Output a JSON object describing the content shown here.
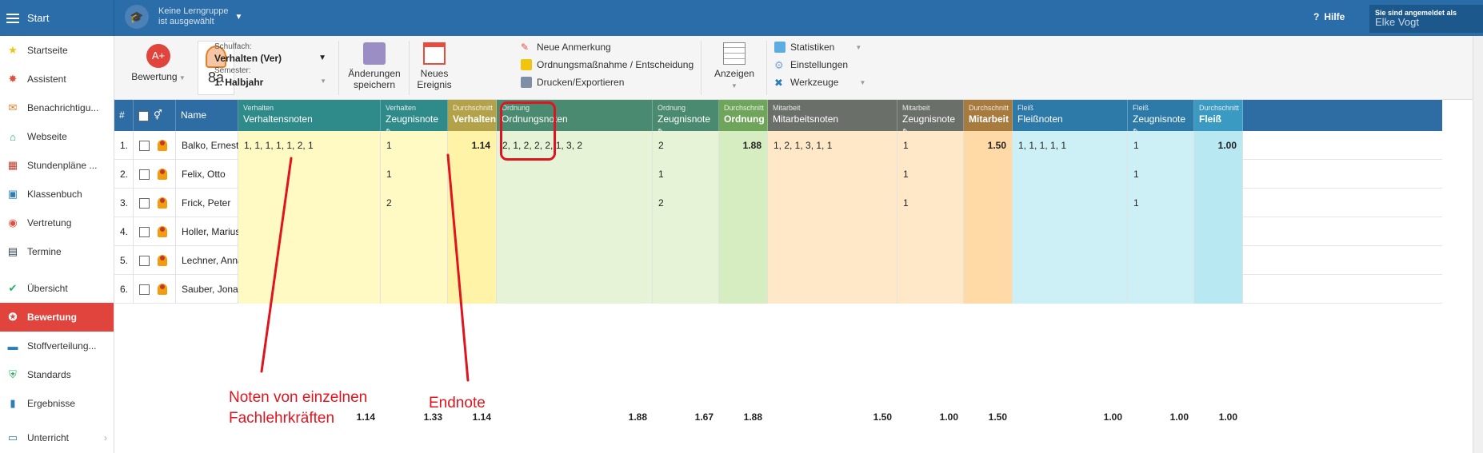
{
  "topbar": {
    "start_label": "Start",
    "group_line1": "Keine Lerngruppe",
    "group_line2": "ist ausgewählt",
    "help_label": "Hilfe",
    "user_caption": "Sie sind angemeldet als",
    "user_name": "Elke Vogt"
  },
  "sidebar": {
    "items": [
      {
        "label": "Startseite",
        "icon": "star-icon",
        "color": "#f1c40f"
      },
      {
        "label": "Assistent",
        "icon": "wand-icon",
        "color": "#e74c3c"
      },
      {
        "label": "Benachrichtigu...",
        "icon": "envelope-icon",
        "color": "#e67e22"
      },
      {
        "label": "Webseite",
        "icon": "home-icon",
        "color": "#27ae60"
      },
      {
        "label": "Stundenpläne ...",
        "icon": "timetable-icon",
        "color": "#c0392b"
      },
      {
        "label": "Klassenbuch",
        "icon": "book-icon",
        "color": "#2980b9"
      },
      {
        "label": "Vertretung",
        "icon": "substitute-icon",
        "color": "#e74c3c"
      },
      {
        "label": "Termine",
        "icon": "calendar-icon",
        "color": "#2c3e50"
      },
      {
        "label": "Übersicht",
        "icon": "check-icon",
        "color": "#27ae60"
      },
      {
        "label": "Bewertung",
        "icon": "grade-icon",
        "color": "#ffffff"
      },
      {
        "label": "Stoffverteilung...",
        "icon": "briefcase-icon",
        "color": "#2980b9"
      },
      {
        "label": "Standards",
        "icon": "shield-icon",
        "color": "#27ae60"
      },
      {
        "label": "Ergebnisse",
        "icon": "bar-chart-icon",
        "color": "#2980b9"
      },
      {
        "label": "Unterricht",
        "icon": "board-icon",
        "color": "#2980b9"
      }
    ]
  },
  "toolbar": {
    "bewertung_label": "Bewertung",
    "class_label": "8a",
    "subject_caption": "Schulfach:",
    "subject_value": "Verhalten (Ver)",
    "semester_caption": "Semester:",
    "semester_value": "1. Halbjahr",
    "save_label_1": "Änderungen",
    "save_label_2": "speichern",
    "event_label_1": "Neues",
    "event_label_2": "Ereignis",
    "note_label": "Neue Anmerkung",
    "order_label": "Ordnungsmaßnahme / Entscheidung",
    "print_label": "Drucken/Exportieren",
    "view_label": "Anzeigen",
    "stats_label": "Statistiken",
    "settings_label": "Einstellungen",
    "tools_label": "Werkzeuge"
  },
  "table": {
    "headers": {
      "num": "#",
      "name": "Name",
      "c1_sub": "Verhalten",
      "c1_main": "Verhaltensnoten",
      "c2_sub": "Verhalten",
      "c2_main": "Zeugnisnote",
      "c3_sub": "Durchschnitt",
      "c3_main": "Verhalten",
      "c4_sub": "Ordnung",
      "c4_main": "Ordnungsnoten",
      "c5_sub": "Ordnung",
      "c5_main": "Zeugnisnote",
      "c6_sub": "Durchschnitt",
      "c6_main": "Ordnung",
      "c7_sub": "Mitarbeit",
      "c7_main": "Mitarbeitsnoten",
      "c8_sub": "Mitarbeit",
      "c8_main": "Zeugnisnote",
      "c9_sub": "Durchschnitt",
      "c9_main": "Mitarbeit",
      "c10_sub": "Fleiß",
      "c10_main": "Fleißnoten",
      "c11_sub": "Fleiß",
      "c11_main": "Zeugnisnote",
      "c12_sub": "Durchschnitt",
      "c12_main": "Fleiß"
    },
    "rows": [
      {
        "num": "1.",
        "name": "Balko, Ernest",
        "c1": "1, 1, 1, 1, 1, 2, 1",
        "c2": "1",
        "c3": "1.14",
        "c4": "2, 1, 2, 2, 2, 1, 3, 2",
        "c5": "2",
        "c6": "1.88",
        "c7": "1, 2, 1, 3, 1, 1",
        "c8": "1",
        "c9": "1.50",
        "c10": "1, 1, 1, 1, 1",
        "c11": "1",
        "c12": "1.00"
      },
      {
        "num": "2.",
        "name": "Felix, Otto",
        "c1": "",
        "c2": "1",
        "c3": "",
        "c4": "",
        "c5": "1",
        "c6": "",
        "c7": "",
        "c8": "1",
        "c9": "",
        "c10": "",
        "c11": "1",
        "c12": ""
      },
      {
        "num": "3.",
        "name": "Frick, Peter",
        "c1": "",
        "c2": "2",
        "c3": "",
        "c4": "",
        "c5": "2",
        "c6": "",
        "c7": "",
        "c8": "1",
        "c9": "",
        "c10": "",
        "c11": "1",
        "c12": ""
      },
      {
        "num": "4.",
        "name": "Holler, Marius",
        "c1": "",
        "c2": "",
        "c3": "",
        "c4": "",
        "c5": "",
        "c6": "",
        "c7": "",
        "c8": "",
        "c9": "",
        "c10": "",
        "c11": "",
        "c12": ""
      },
      {
        "num": "5.",
        "name": "Lechner, Anna",
        "c1": "",
        "c2": "",
        "c3": "",
        "c4": "",
        "c5": "",
        "c6": "",
        "c7": "",
        "c8": "",
        "c9": "",
        "c10": "",
        "c11": "",
        "c12": ""
      },
      {
        "num": "6.",
        "name": "Sauber, Jonas",
        "c1": "",
        "c2": "",
        "c3": "",
        "c4": "",
        "c5": "",
        "c6": "",
        "c7": "",
        "c8": "",
        "c9": "",
        "c10": "",
        "c11": "",
        "c12": ""
      }
    ],
    "averages": {
      "c1": "1.14",
      "c2": "1.33",
      "c3": "1.14",
      "c4": "1.88",
      "c5": "1.67",
      "c6": "1.88",
      "c7": "1.50",
      "c8": "1.00",
      "c9": "1.50",
      "c10": "1.00",
      "c11": "1.00",
      "c12": "1.00"
    }
  },
  "annotations": {
    "left_line1": "Noten von einzelnen",
    "left_line2": "Fachlehrkräften",
    "right": "Endnote"
  },
  "colors": {
    "brand": "#2a6da8",
    "verhalten": "#fff9c4",
    "ordnung": "#e6f3d6",
    "mitarbeit": "#ffe8c8",
    "fleiss": "#ccf0f5",
    "annotation": "#e0141e"
  }
}
